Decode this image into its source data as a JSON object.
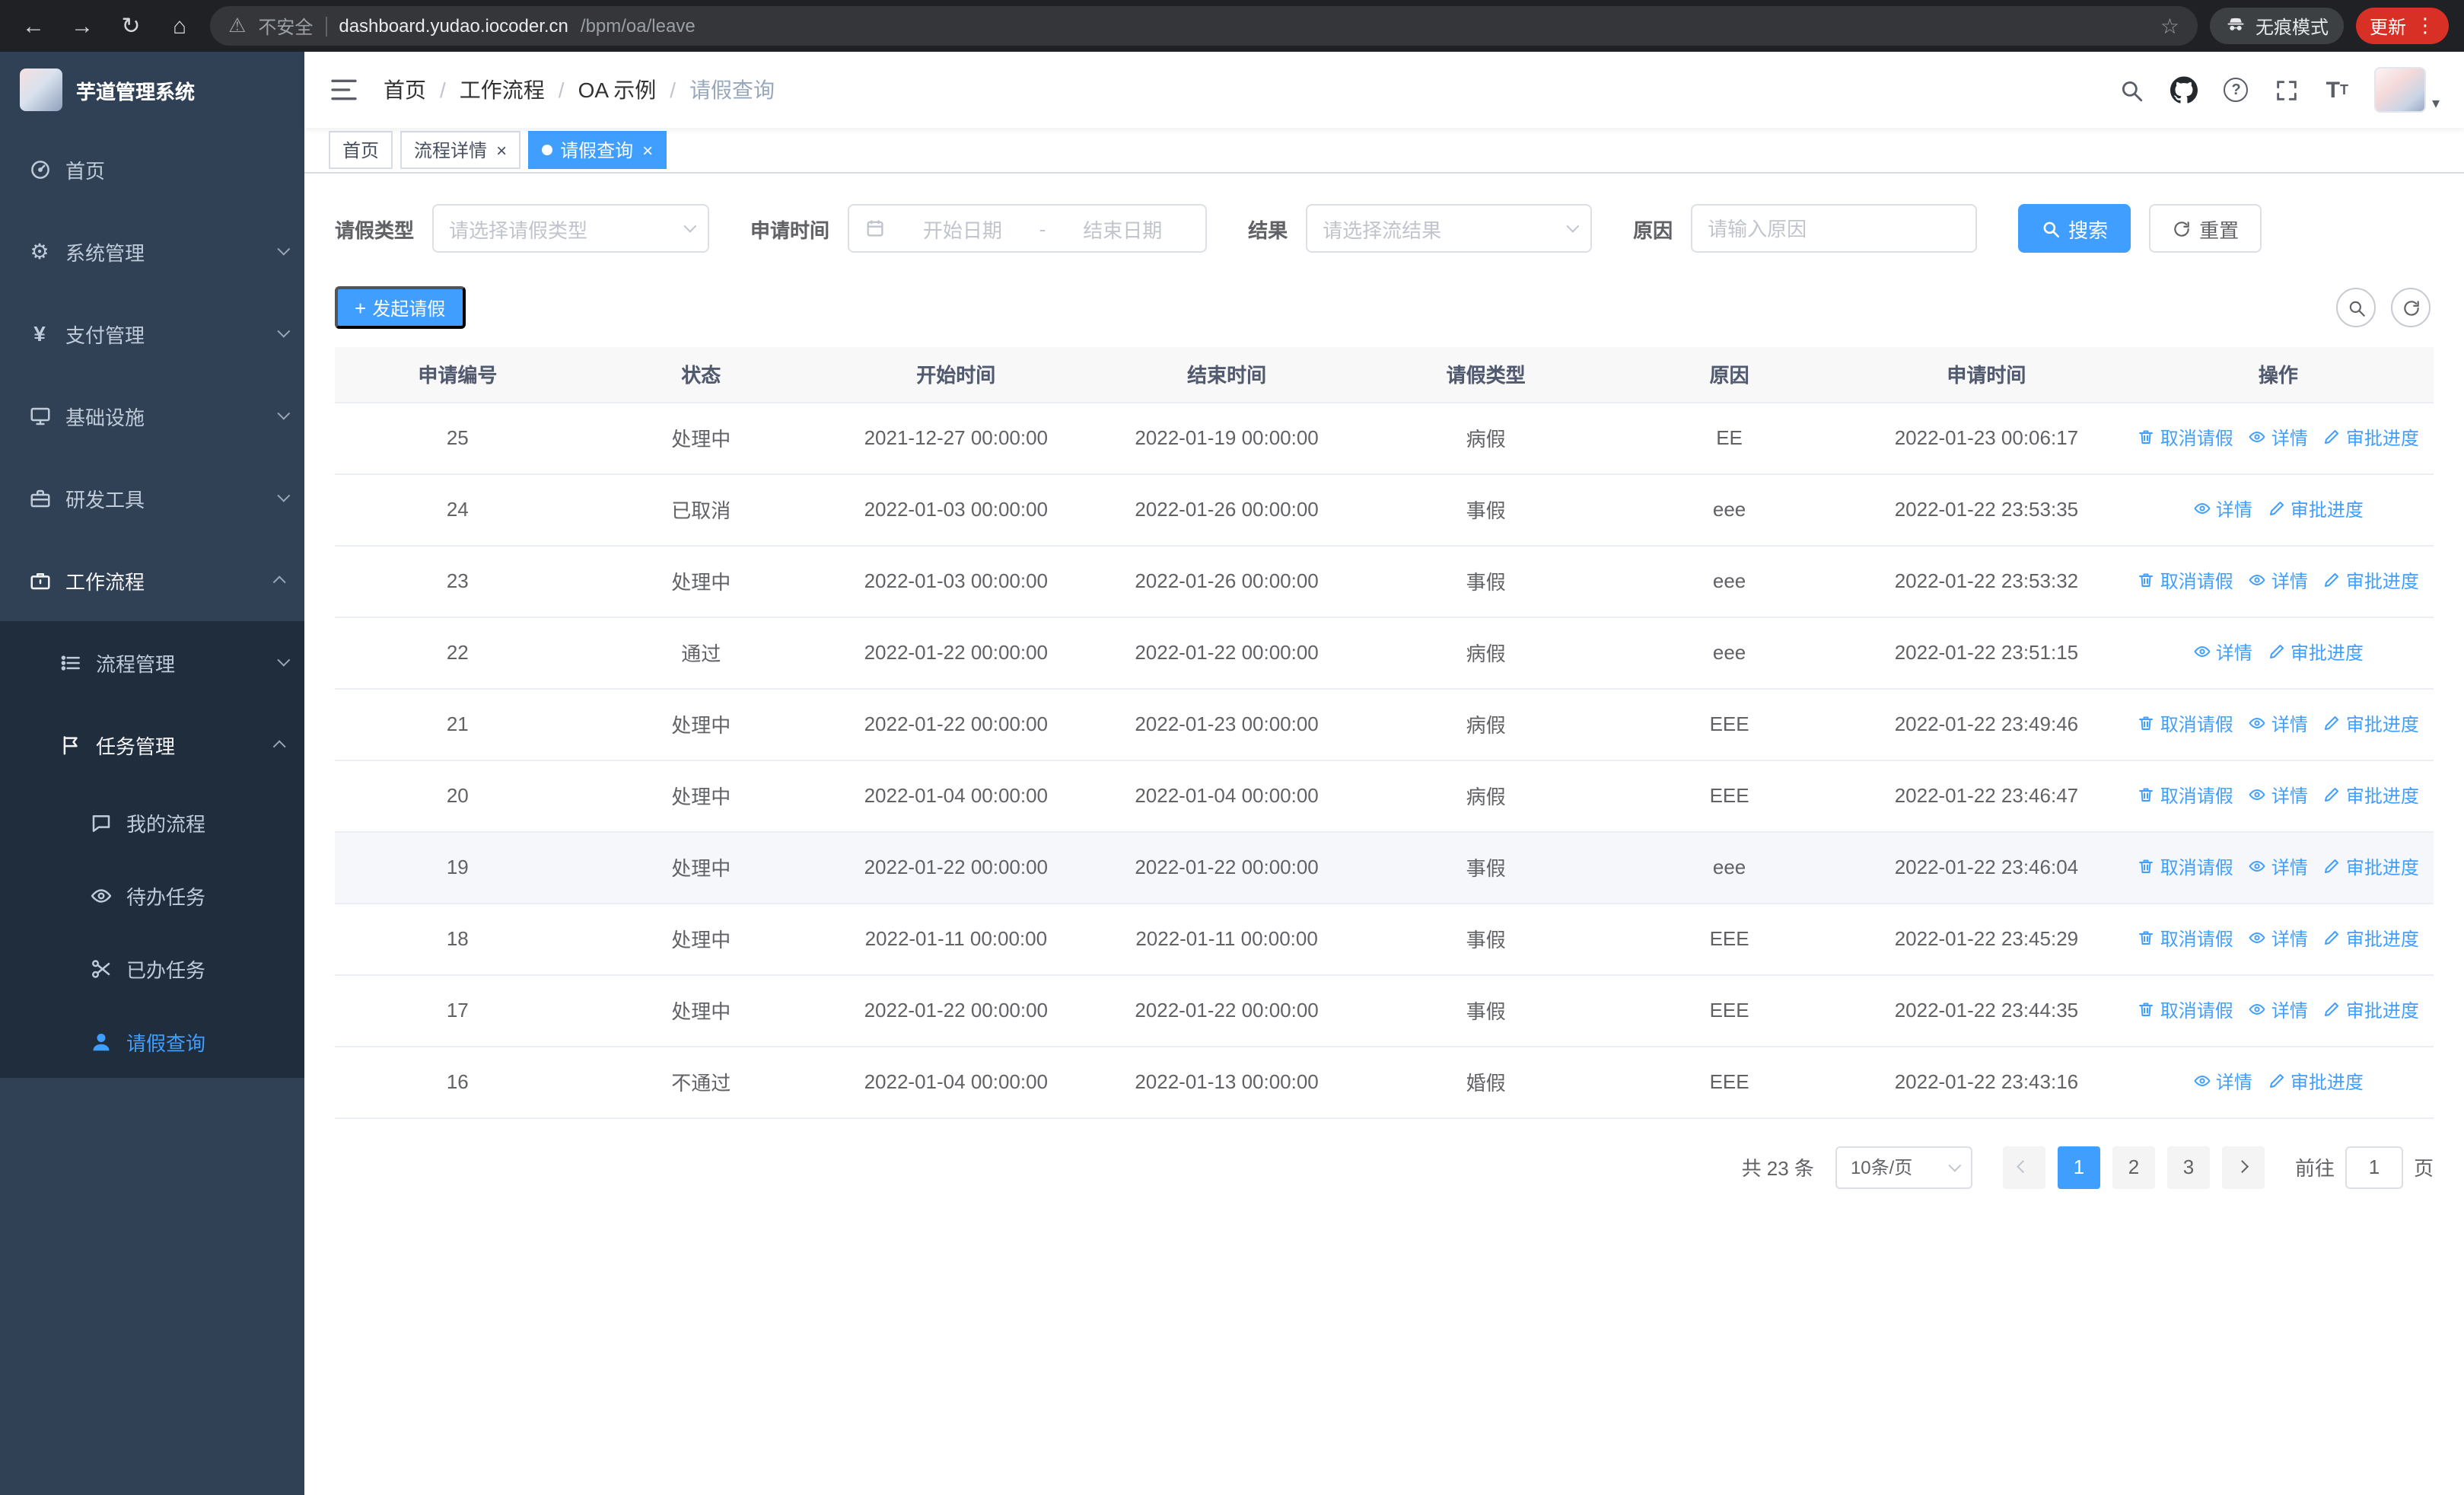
{
  "browser": {
    "security_label": "不安全",
    "url_host": "dashboard.yudao.iocoder.cn",
    "url_path": "/bpm/oa/leave",
    "incognito_label": "无痕模式",
    "update_label": "更新"
  },
  "icons": {
    "back": "←",
    "forward": "→",
    "reload": "↻",
    "home": "⌂",
    "warning": "⚠",
    "star": "☆",
    "dots": "⋮",
    "close": "×",
    "gear": "⚙",
    "yen": "¥",
    "caret_down": "▾",
    "plus": "+",
    "range_sep": "-"
  },
  "sidebar": {
    "app_title": "芋道管理系统",
    "menu": [
      {
        "key": "home",
        "label": "首页",
        "icon": "dashboard-icon",
        "level": 1
      },
      {
        "key": "system",
        "label": "系统管理",
        "icon": "gear-icon",
        "level": 1,
        "arrow": "down"
      },
      {
        "key": "payment",
        "label": "支付管理",
        "icon": "yen-icon",
        "level": 1,
        "arrow": "down"
      },
      {
        "key": "infrastructure",
        "label": "基础设施",
        "icon": "monitor-icon",
        "level": 1,
        "arrow": "down"
      },
      {
        "key": "devtools",
        "label": "研发工具",
        "icon": "toolbox-icon",
        "level": 1,
        "arrow": "down"
      },
      {
        "key": "workflow",
        "label": "工作流程",
        "icon": "briefcase-icon",
        "level": 1,
        "arrow": "up",
        "open": true
      },
      {
        "key": "process-mgmt",
        "label": "流程管理",
        "icon": "list-icon",
        "level": 2,
        "arrow": "down"
      },
      {
        "key": "task-mgmt",
        "label": "任务管理",
        "icon": "flag-icon",
        "level": 2,
        "arrow": "up",
        "open": true
      },
      {
        "key": "my-process",
        "label": "我的流程",
        "icon": "chat-icon",
        "level": 3
      },
      {
        "key": "todo-tasks",
        "label": "待办任务",
        "icon": "eye-icon",
        "level": 3
      },
      {
        "key": "done-tasks",
        "label": "已办任务",
        "icon": "scissors-icon",
        "level": 3
      },
      {
        "key": "leave-query",
        "label": "请假查询",
        "icon": "user-icon",
        "level": 3,
        "active": true
      }
    ]
  },
  "header": {
    "breadcrumb": [
      "首页",
      "工作流程",
      "OA 示例",
      "请假查询"
    ],
    "breadcrumb_separator": "/"
  },
  "tabs": [
    {
      "key": "home",
      "label": "首页",
      "closable": false,
      "active": false
    },
    {
      "key": "process-detail",
      "label": "流程详情",
      "closable": true,
      "active": false
    },
    {
      "key": "leave-query",
      "label": "请假查询",
      "closable": true,
      "active": true
    }
  ],
  "filters": {
    "leave_type_label": "请假类型",
    "leave_type_placeholder": "请选择请假类型",
    "apply_time_label": "申请时间",
    "start_date_placeholder": "开始日期",
    "end_date_placeholder": "结束日期",
    "result_label": "结果",
    "result_placeholder": "请选择流结果",
    "reason_label": "原因",
    "reason_placeholder": "请输入原因",
    "search_button": "搜索",
    "reset_button": "重置"
  },
  "toolbar": {
    "create_button": "发起请假"
  },
  "table": {
    "columns": [
      "申请编号",
      "状态",
      "开始时间",
      "结束时间",
      "请假类型",
      "原因",
      "申请时间",
      "操作"
    ],
    "action_labels": {
      "cancel": "取消请假",
      "detail": "详情",
      "progress": "审批进度"
    },
    "rows": [
      {
        "id": "25",
        "status": "处理中",
        "start": "2021-12-27 00:00:00",
        "end": "2022-01-19 00:00:00",
        "type": "病假",
        "reason": "EE",
        "applied": "2022-01-23 00:06:17",
        "actions": [
          "cancel",
          "detail",
          "progress"
        ]
      },
      {
        "id": "24",
        "status": "已取消",
        "start": "2022-01-03 00:00:00",
        "end": "2022-01-26 00:00:00",
        "type": "事假",
        "reason": "eee",
        "applied": "2022-01-22 23:53:35",
        "actions": [
          "detail",
          "progress"
        ]
      },
      {
        "id": "23",
        "status": "处理中",
        "start": "2022-01-03 00:00:00",
        "end": "2022-01-26 00:00:00",
        "type": "事假",
        "reason": "eee",
        "applied": "2022-01-22 23:53:32",
        "actions": [
          "cancel",
          "detail",
          "progress"
        ]
      },
      {
        "id": "22",
        "status": "通过",
        "start": "2022-01-22 00:00:00",
        "end": "2022-01-22 00:00:00",
        "type": "病假",
        "reason": "eee",
        "applied": "2022-01-22 23:51:15",
        "actions": [
          "detail",
          "progress"
        ]
      },
      {
        "id": "21",
        "status": "处理中",
        "start": "2022-01-22 00:00:00",
        "end": "2022-01-23 00:00:00",
        "type": "病假",
        "reason": "EEE",
        "applied": "2022-01-22 23:49:46",
        "actions": [
          "cancel",
          "detail",
          "progress"
        ]
      },
      {
        "id": "20",
        "status": "处理中",
        "start": "2022-01-04 00:00:00",
        "end": "2022-01-04 00:00:00",
        "type": "病假",
        "reason": "EEE",
        "applied": "2022-01-22 23:46:47",
        "actions": [
          "cancel",
          "detail",
          "progress"
        ]
      },
      {
        "id": "19",
        "status": "处理中",
        "start": "2022-01-22 00:00:00",
        "end": "2022-01-22 00:00:00",
        "type": "事假",
        "reason": "eee",
        "applied": "2022-01-22 23:46:04",
        "actions": [
          "cancel",
          "detail",
          "progress"
        ],
        "hover": true
      },
      {
        "id": "18",
        "status": "处理中",
        "start": "2022-01-11 00:00:00",
        "end": "2022-01-11 00:00:00",
        "type": "事假",
        "reason": "EEE",
        "applied": "2022-01-22 23:45:29",
        "actions": [
          "cancel",
          "detail",
          "progress"
        ]
      },
      {
        "id": "17",
        "status": "处理中",
        "start": "2022-01-22 00:00:00",
        "end": "2022-01-22 00:00:00",
        "type": "事假",
        "reason": "EEE",
        "applied": "2022-01-22 23:44:35",
        "actions": [
          "cancel",
          "detail",
          "progress"
        ]
      },
      {
        "id": "16",
        "status": "不通过",
        "start": "2022-01-04 00:00:00",
        "end": "2022-01-13 00:00:00",
        "type": "婚假",
        "reason": "EEE",
        "applied": "2022-01-22 23:43:16",
        "actions": [
          "detail",
          "progress"
        ]
      }
    ]
  },
  "pagination": {
    "total_label": "共 23 条",
    "page_size": "10条/页",
    "pages": [
      "1",
      "2",
      "3"
    ],
    "active_page": "1",
    "goto_label": "前往",
    "goto_value": "1",
    "page_unit": "页"
  },
  "colors": {
    "primary": "#409EFF",
    "sidebar_bg": "#304156",
    "sidebar_sub_bg": "#1F2D3D",
    "browser_bar_bg": "#202124",
    "update_chip_bg": "#D93025"
  }
}
